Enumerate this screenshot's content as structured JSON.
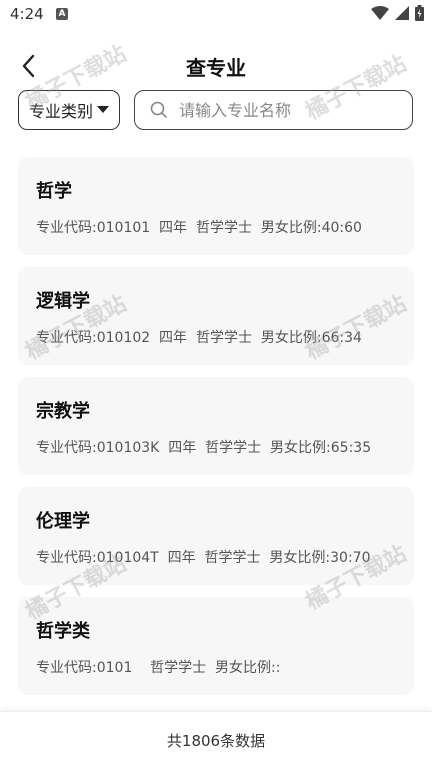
{
  "status": {
    "time": "4:24",
    "notif": "A"
  },
  "header": {
    "title": "查专业"
  },
  "filter": {
    "category_label": "专业类别",
    "search_placeholder": "请输入专业名称"
  },
  "majors": [
    {
      "name": "哲学",
      "info": "专业代码:010101  四年  哲学学士  男女比例:40:60"
    },
    {
      "name": "逻辑学",
      "info": "专业代码:010102  四年  哲学学士  男女比例:66:34"
    },
    {
      "name": "宗教学",
      "info": "专业代码:010103K  四年  哲学学士  男女比例:65:35"
    },
    {
      "name": "伦理学",
      "info": "专业代码:010104T  四年  哲学学士  男女比例:30:70"
    },
    {
      "name": "哲学类",
      "info": "专业代码:0101    哲学学士  男女比例::"
    }
  ],
  "footer": {
    "total": "共1806条数据"
  },
  "watermark": "橘子下载站"
}
